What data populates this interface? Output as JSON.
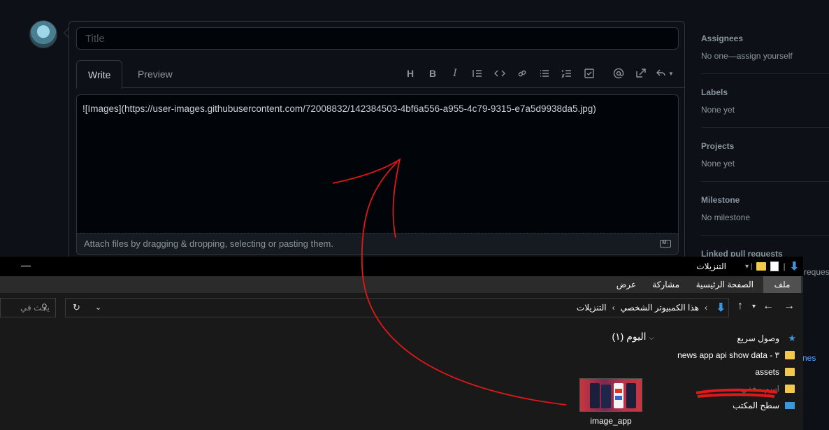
{
  "issue": {
    "title_placeholder": "Title",
    "tabs": [
      {
        "label": "Write"
      },
      {
        "label": "Preview"
      }
    ],
    "toolbar": {
      "heading_label": "H",
      "bold_label": "B",
      "italic_label": "I"
    },
    "body_text": "![Images](https://user-images.githubusercontent.com/72008832/142384503-4bf6a556-a955-4c79-9315-e7a5d9938da5.jpg)",
    "attach_text": "Attach files by dragging & dropping, selecting or pasting them.",
    "markdown_badge": "M↓"
  },
  "sidebar": {
    "sections": [
      {
        "heading": "Assignees",
        "value": "No one—assign yourself"
      },
      {
        "heading": "Labels",
        "value": "None yet"
      },
      {
        "heading": "Projects",
        "value": "None yet"
      },
      {
        "heading": "Milestone",
        "value": "No milestone"
      },
      {
        "heading": "Linked pull requests",
        "value": ""
      }
    ],
    "tail_text": "reques",
    "link_tail": "nes"
  },
  "explorer": {
    "title": "التنزيلات",
    "minimize": "—",
    "ribbon_tabs": [
      {
        "label": "ملف"
      },
      {
        "label": "الصفحة الرئيسية"
      },
      {
        "label": "مشاركة"
      },
      {
        "label": "عرض"
      }
    ],
    "address": {
      "segments": [
        "هذا الكمبيوتر الشخصي",
        "التنزيلات"
      ],
      "separator": "›"
    },
    "search_placeholder": "يحث في",
    "group_header": "اليوم (١)",
    "file": {
      "name": "image_app"
    },
    "nav_pane": [
      {
        "label": "وصول سريع"
      },
      {
        "label": "news app api show data - ٣"
      },
      {
        "label": "assets"
      },
      {
        "label": "اسم مخفي"
      },
      {
        "label": "سطح المكتب"
      }
    ]
  },
  "colors": {
    "github_bg": "#0d1117",
    "border": "#30363d",
    "accent_blue": "#3a96dd",
    "annotation_red": "#e01818"
  }
}
